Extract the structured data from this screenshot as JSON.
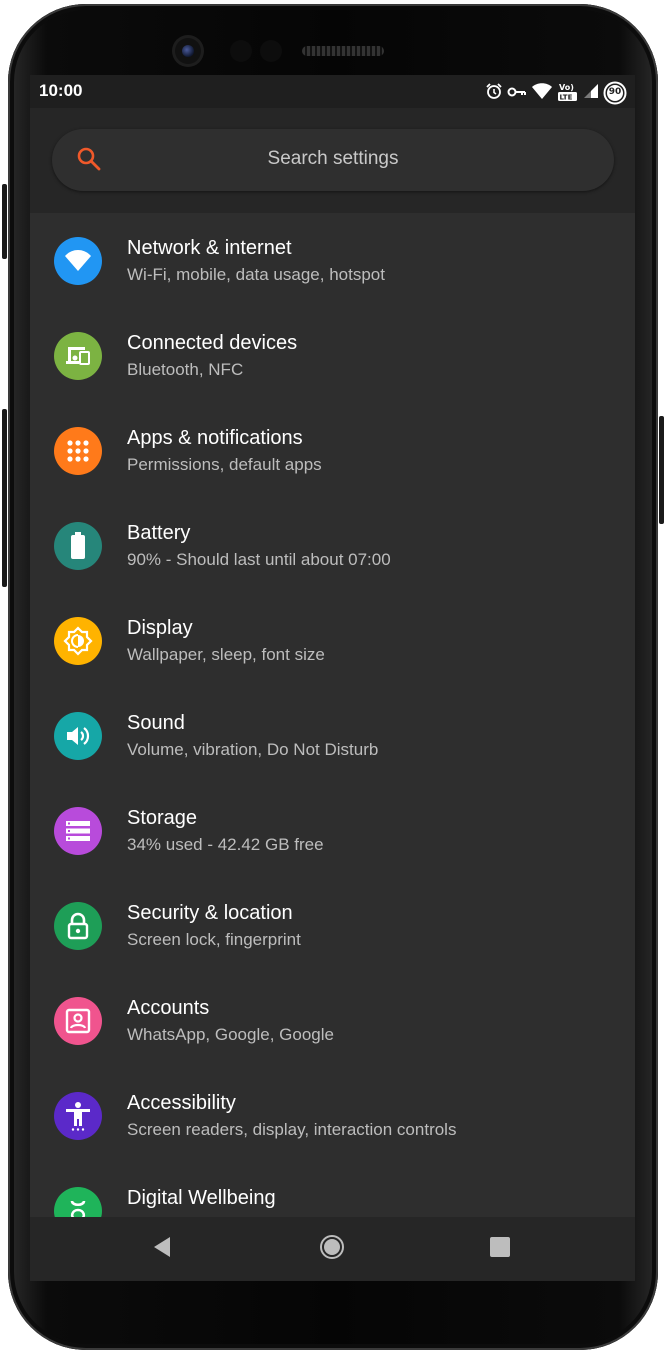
{
  "status_bar": {
    "time": "10:00",
    "battery_level": "90",
    "icons": [
      "alarm-icon",
      "vpn-key-icon",
      "wifi-icon",
      "volte-icon",
      "signal-icon",
      "battery-icon"
    ]
  },
  "search": {
    "placeholder": "Search settings",
    "icon": "search-icon"
  },
  "settings": [
    {
      "title": "Network & internet",
      "subtitle": "Wi-Fi, mobile, data usage, hotspot",
      "color": "#2196f3",
      "icon": "wifi-icon"
    },
    {
      "title": "Connected devices",
      "subtitle": "Bluetooth, NFC",
      "color": "#7cb342",
      "icon": "devices-icon"
    },
    {
      "title": "Apps & notifications",
      "subtitle": "Permissions, default apps",
      "color": "#ff7a1a",
      "icon": "apps-grid-icon"
    },
    {
      "title": "Battery",
      "subtitle": "90% - Should last until about 07:00",
      "color": "#26867a",
      "icon": "battery-icon"
    },
    {
      "title": "Display",
      "subtitle": "Wallpaper, sleep, font size",
      "color": "#ffb300",
      "icon": "brightness-icon"
    },
    {
      "title": "Sound",
      "subtitle": "Volume, vibration, Do Not Disturb",
      "color": "#16a7a7",
      "icon": "volume-icon"
    },
    {
      "title": "Storage",
      "subtitle": "34% used - 42.42 GB free",
      "color": "#b84bdb",
      "icon": "storage-icon"
    },
    {
      "title": "Security & location",
      "subtitle": "Screen lock, fingerprint",
      "color": "#1e9e57",
      "icon": "lock-icon"
    },
    {
      "title": "Accounts",
      "subtitle": "WhatsApp, Google, Google",
      "color": "#f0548e",
      "icon": "account-box-icon"
    },
    {
      "title": "Accessibility",
      "subtitle": "Screen readers, display, interaction controls",
      "color": "#5b29c9",
      "icon": "accessibility-icon"
    },
    {
      "title": "Digital Wellbeing",
      "subtitle": "",
      "color": "#1fb45a",
      "icon": "wellbeing-icon"
    }
  ],
  "nav_bar": {
    "back": "back-icon",
    "home": "home-icon",
    "recents": "recents-icon"
  },
  "colors": {
    "screen_bg": "#2e2e2e",
    "search_accent": "#f0592a"
  }
}
